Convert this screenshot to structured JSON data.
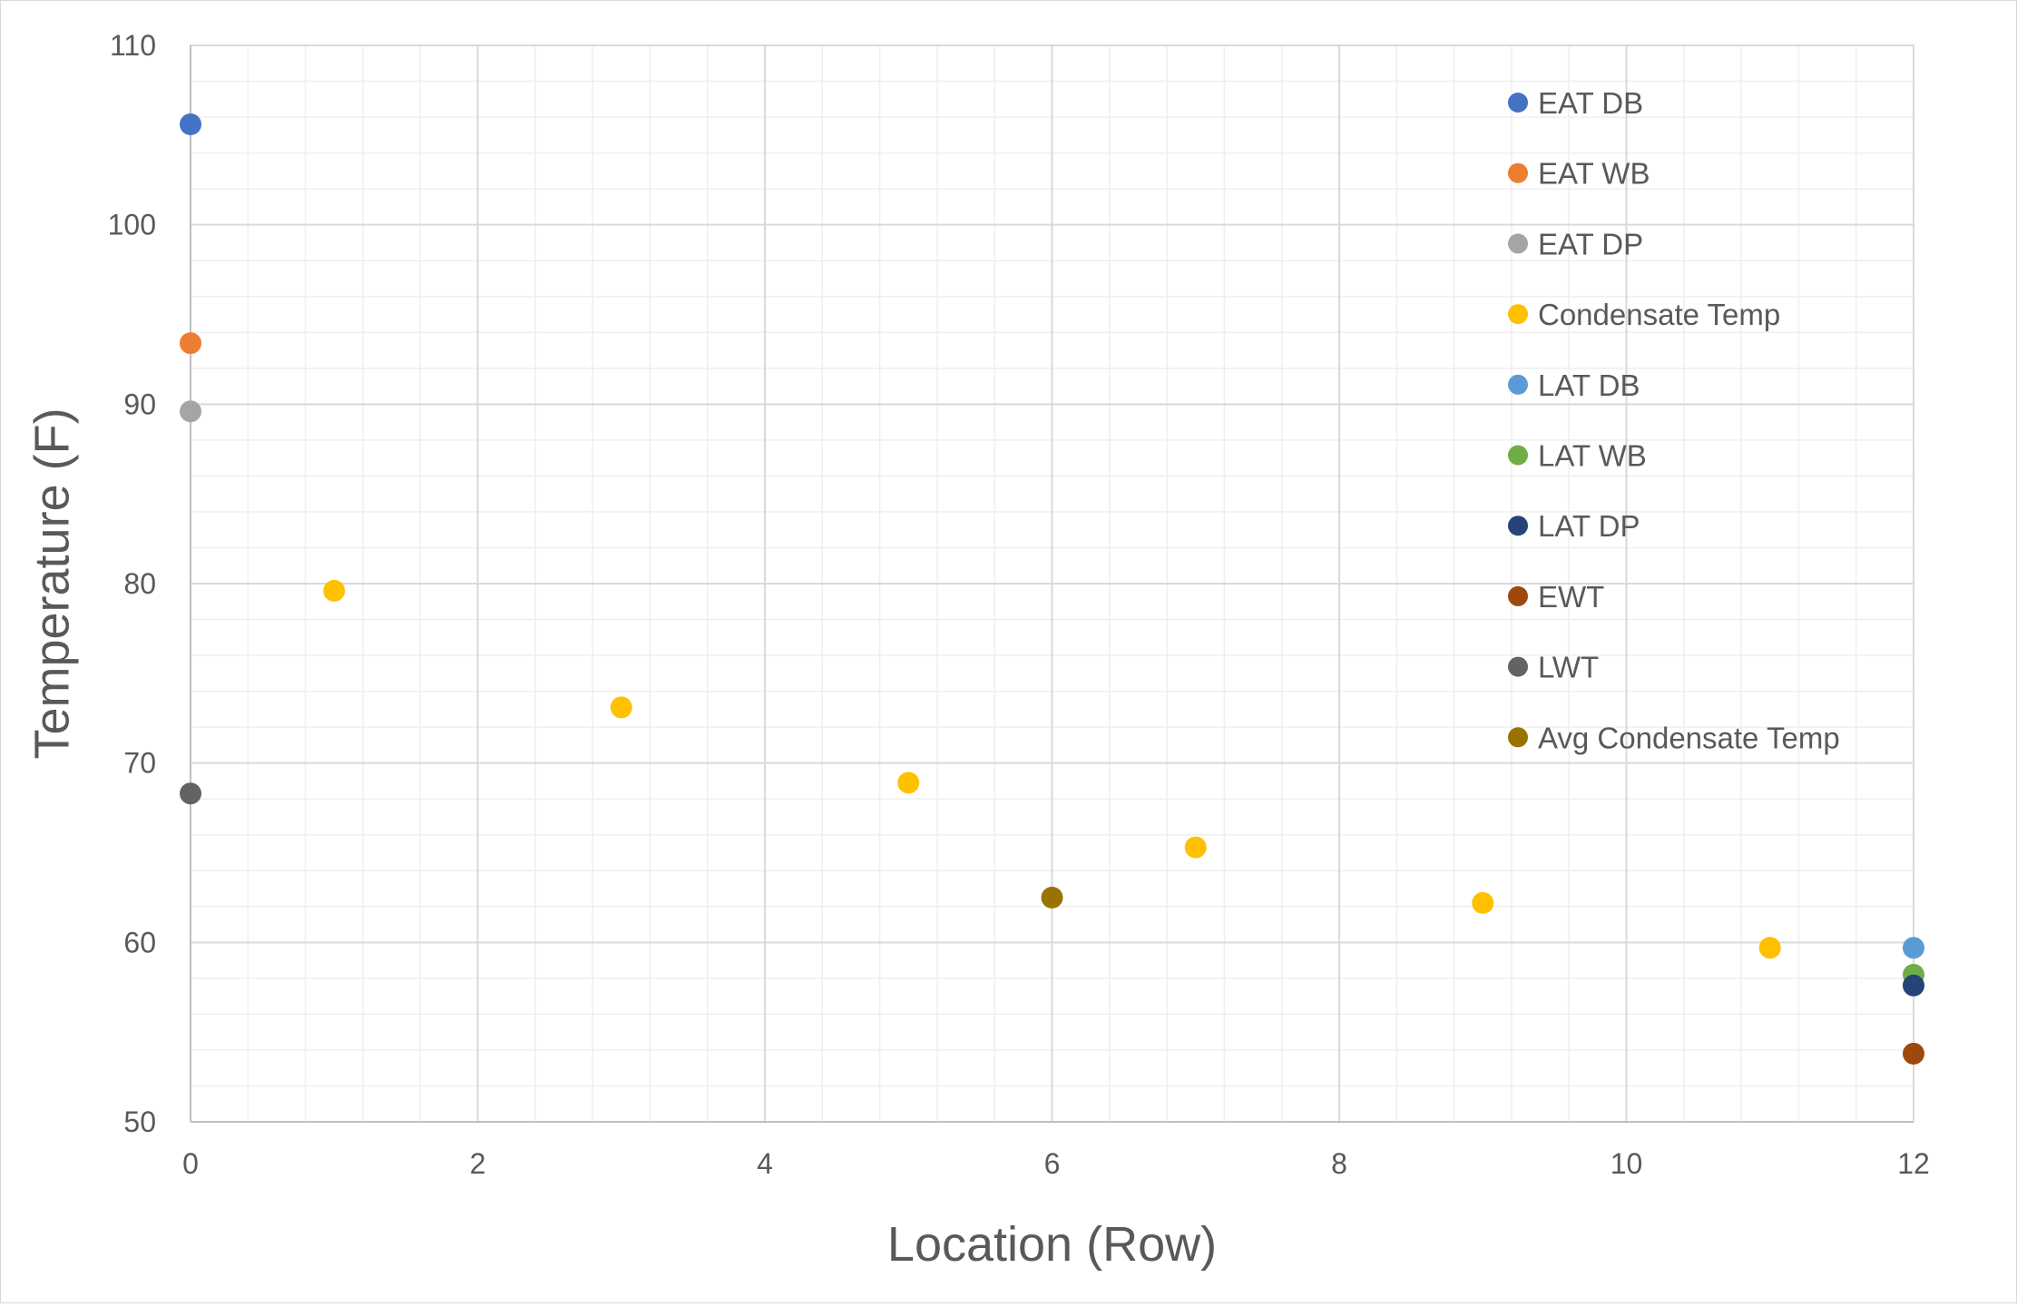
{
  "chart_data": {
    "type": "scatter",
    "title": "",
    "xlabel": "Location (Row)",
    "ylabel": "Temperature (F)",
    "xlim": [
      0,
      12
    ],
    "ylim": [
      50,
      110
    ],
    "xticks": [
      0,
      2,
      4,
      6,
      8,
      10,
      12
    ],
    "yticks": [
      50,
      60,
      70,
      80,
      90,
      100,
      110
    ],
    "x_minor_step": 0.4,
    "y_minor_step": 2,
    "grid": true,
    "legend_position": "top-right",
    "series": [
      {
        "name": "EAT DB",
        "color": "#4472C4",
        "points": [
          {
            "x": 0,
            "y": 105.6
          }
        ]
      },
      {
        "name": "EAT WB",
        "color": "#ED7D31",
        "points": [
          {
            "x": 0,
            "y": 93.4
          }
        ]
      },
      {
        "name": "EAT DP",
        "color": "#A5A5A5",
        "points": [
          {
            "x": 0,
            "y": 89.6
          }
        ]
      },
      {
        "name": "Condensate Temp",
        "color": "#FFC000",
        "points": [
          {
            "x": 1,
            "y": 79.6
          },
          {
            "x": 3,
            "y": 73.1
          },
          {
            "x": 5,
            "y": 68.9
          },
          {
            "x": 7,
            "y": 65.3
          },
          {
            "x": 9,
            "y": 62.2
          },
          {
            "x": 11,
            "y": 59.7
          }
        ]
      },
      {
        "name": "LAT DB",
        "color": "#5B9BD5",
        "points": [
          {
            "x": 12,
            "y": 59.7
          }
        ]
      },
      {
        "name": "LAT WB",
        "color": "#70AD47",
        "points": [
          {
            "x": 12,
            "y": 58.2
          }
        ]
      },
      {
        "name": "LAT DP",
        "color": "#264478",
        "points": [
          {
            "x": 12,
            "y": 57.6
          }
        ]
      },
      {
        "name": "EWT",
        "color": "#9E480E",
        "points": [
          {
            "x": 12,
            "y": 53.8
          }
        ]
      },
      {
        "name": "LWT",
        "color": "#636363",
        "points": [
          {
            "x": 0,
            "y": 68.3
          }
        ]
      },
      {
        "name": "Avg Condensate Temp",
        "color": "#997300",
        "points": [
          {
            "x": 6,
            "y": 62.5
          }
        ]
      }
    ]
  }
}
